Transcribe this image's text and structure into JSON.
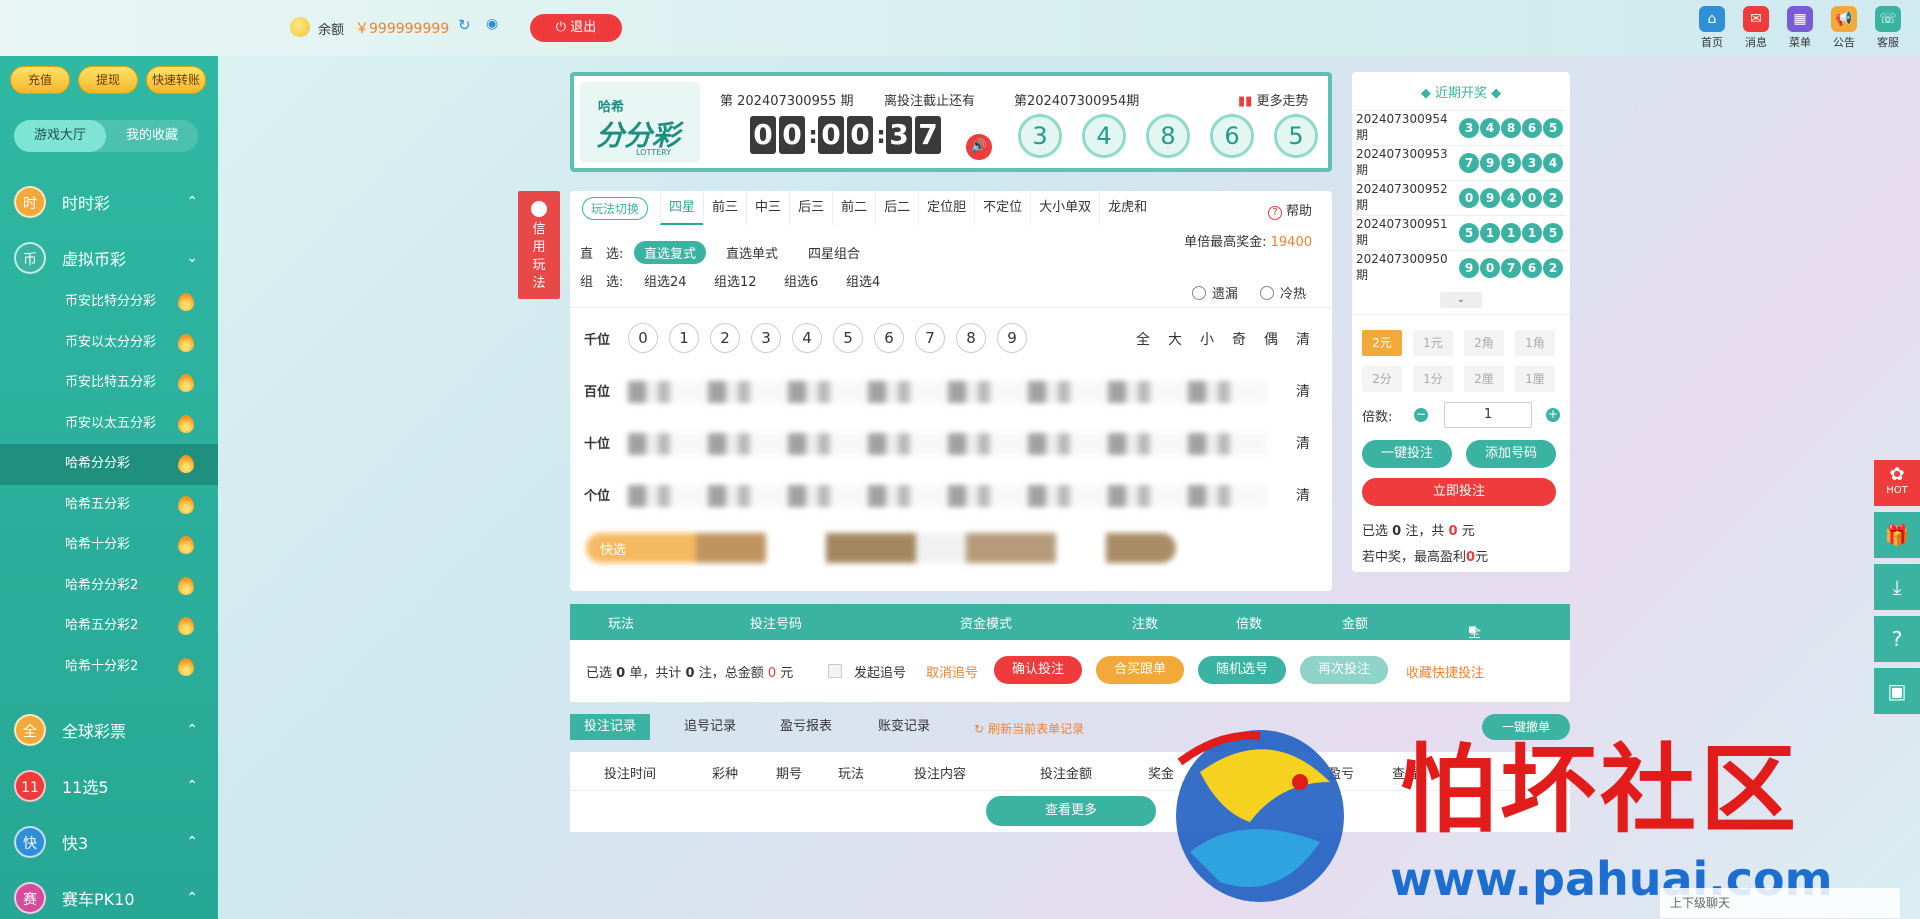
{
  "topbar": {
    "balance_label": "余额",
    "balance_value": "￥999999999",
    "logout": "退出",
    "icons": [
      {
        "label": "首页",
        "icon": "home-icon",
        "color": "#2f8fd8",
        "glyph": "⌂"
      },
      {
        "label": "消息",
        "icon": "mail-icon",
        "color": "#ef3b3b",
        "glyph": "✉"
      },
      {
        "label": "菜单",
        "icon": "menu-icon",
        "color": "#7b5bd6",
        "glyph": "▦"
      },
      {
        "label": "公告",
        "icon": "notice-icon",
        "color": "#f3a93a",
        "glyph": "📢"
      },
      {
        "label": "客服",
        "icon": "support-icon",
        "color": "#3bb3a2",
        "glyph": "☏"
      }
    ]
  },
  "sidebar": {
    "buttons": [
      "充值",
      "提现",
      "快速转账"
    ],
    "tabs": [
      "游戏大厅",
      "我的收藏"
    ],
    "categories_top": [
      {
        "label": "时时彩",
        "ball": "时",
        "color": "#f3a93a"
      },
      {
        "label": "虚拟币彩",
        "ball": "币",
        "color": "#3bb3a2"
      }
    ],
    "sub_items": [
      "币安比特分分彩",
      "币安以太分分彩",
      "币安比特五分彩",
      "币安以太五分彩",
      "哈希分分彩",
      "哈希五分彩",
      "哈希十分彩",
      "哈希分分彩2",
      "哈希五分彩2",
      "哈希十分彩2"
    ],
    "categories_bottom": [
      {
        "label": "全球彩票",
        "ball": "全",
        "color": "#f3a93a"
      },
      {
        "label": "11选5",
        "ball": "11",
        "color": "#ef3b3b"
      },
      {
        "label": "快3",
        "ball": "快",
        "color": "#2f8fd8"
      },
      {
        "label": "赛车PK10",
        "ball": "赛",
        "color": "#d64b9b"
      }
    ]
  },
  "header": {
    "logo_small": "哈希",
    "logo_big": "分分彩",
    "logo_sub": "LOTTERY",
    "current_issue": "第 202407300955 期",
    "deadline_label": "离投注截止还有",
    "timer": [
      "0",
      "0",
      "0",
      "0",
      "3",
      "7"
    ],
    "prev_issue": "第202407300954期",
    "more_trend": "更多走势",
    "draw_balls": [
      "3",
      "4",
      "8",
      "6",
      "5"
    ]
  },
  "credit_tag": "信用玩法",
  "play": {
    "switch_label": "玩法切换",
    "tabs": [
      "四星",
      "前三",
      "中三",
      "后三",
      "前二",
      "后二",
      "定位胆",
      "不定位",
      "大小单双",
      "龙虎和"
    ],
    "help": "帮助",
    "max_prize_label": "单倍最高奖金:",
    "max_prize_value": "19400",
    "direct_label": "直　选:",
    "direct_options": [
      "直选复式",
      "直选单式",
      "四星组合"
    ],
    "group_label": "组　选:",
    "group_options": [
      "组选24",
      "组选12",
      "组选6",
      "组选4"
    ],
    "radio_miss": "遗漏",
    "radio_hot": "冷热",
    "positions": [
      "千位",
      "百位",
      "十位",
      "个位"
    ],
    "digits": [
      "0",
      "1",
      "2",
      "3",
      "4",
      "5",
      "6",
      "7",
      "8",
      "9"
    ],
    "quick_filters": [
      "全",
      "大",
      "小",
      "奇",
      "偶",
      "清"
    ],
    "clear": "清",
    "quick_label": "快选"
  },
  "right": {
    "recent_title": "近期开奖",
    "recent": [
      {
        "issue": "202407300954期",
        "balls": [
          "3",
          "4",
          "8",
          "6",
          "5"
        ]
      },
      {
        "issue": "202407300953期",
        "balls": [
          "7",
          "9",
          "9",
          "3",
          "4"
        ]
      },
      {
        "issue": "202407300952期",
        "balls": [
          "0",
          "9",
          "4",
          "0",
          "2"
        ]
      },
      {
        "issue": "202407300951期",
        "balls": [
          "5",
          "1",
          "1",
          "1",
          "5"
        ]
      },
      {
        "issue": "202407300950期",
        "balls": [
          "9",
          "0",
          "7",
          "6",
          "2"
        ]
      }
    ],
    "units_row1": [
      "2元",
      "1元",
      "2角",
      "1角"
    ],
    "units_row2": [
      "2分",
      "1分",
      "2厘",
      "1厘"
    ],
    "multiplier_label": "倍数:",
    "multiplier_value": "1",
    "one_click": "一键投注",
    "add_number": "添加号码",
    "bet_now": "立即投注",
    "selected_prefix": "已选",
    "selected_count": "0",
    "selected_mid": "注，共",
    "selected_amount": "0",
    "selected_suffix": "元",
    "win_prefix": "若中奖，最高盈利",
    "win_value": "0",
    "win_suffix": "元"
  },
  "bet_list": {
    "headers": [
      "玩法",
      "投注号码",
      "资金模式",
      "注数",
      "倍数",
      "金额",
      "全删"
    ],
    "summary_prefix": "已选",
    "summary_orders": "0",
    "summary_mid1": "单，共计",
    "summary_bets": "0",
    "summary_mid2": "注，总金额",
    "summary_amount": "0",
    "summary_suffix": "元",
    "chase_label": "发起追号",
    "cancel_chase": "取消追号",
    "confirm": "确认投注",
    "group_buy": "合买跟单",
    "random": "随机选号",
    "again": "再次投注",
    "fav_quick": "收藏快捷投注"
  },
  "records": {
    "tabs": [
      "投注记录",
      "追号记录",
      "盈亏报表",
      "账变记录"
    ],
    "refresh": "刷新当前表单记录",
    "one_cancel": "一键撤单",
    "columns": [
      "投注时间",
      "彩种",
      "期号",
      "玩法",
      "投注内容",
      "投注金额",
      "奖金",
      "状态",
      "盈亏",
      "查看"
    ],
    "view_more": "查看更多"
  },
  "float_bar": {
    "hot": "HOT"
  },
  "watermark": {
    "text": "怕坏社区",
    "url": "www.pahuai.com"
  },
  "chat_bar": "上下级聊天"
}
